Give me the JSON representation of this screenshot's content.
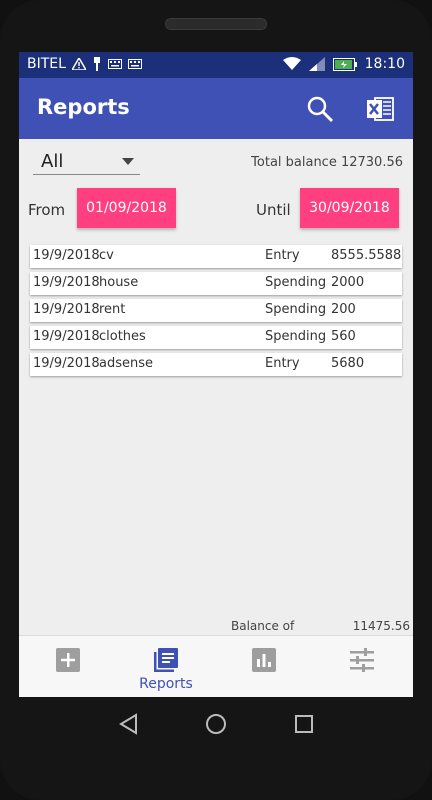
{
  "status": {
    "carrier": "BITEL",
    "time": "18:10"
  },
  "appbar": {
    "title": "Reports",
    "search_icon": "search-icon",
    "excel_icon": "excel-icon"
  },
  "filter": {
    "selected": "All",
    "total_balance": "Total balance 12730.56"
  },
  "dates": {
    "from_label": "From",
    "from_value": "01/09/2018",
    "until_label": "Until",
    "until_value": "30/09/2018"
  },
  "transactions": [
    {
      "date": "19/9/2018",
      "desc": "cv",
      "type": "Entry",
      "amount": "8555.5588"
    },
    {
      "date": "19/9/2018",
      "desc": "house",
      "type": "Spending",
      "amount": "2000"
    },
    {
      "date": "19/9/2018",
      "desc": "rent",
      "type": "Spending",
      "amount": "200"
    },
    {
      "date": "19/9/2018",
      "desc": "clothes",
      "type": "Spending",
      "amount": "560"
    },
    {
      "date": "19/9/2018",
      "desc": "adsense",
      "type": "Entry",
      "amount": "5680"
    }
  ],
  "footer": {
    "balance_label": "Balance of",
    "balance_value": "11475.56"
  },
  "bottom_nav": [
    {
      "icon": "add-icon",
      "label": ""
    },
    {
      "icon": "reports-icon",
      "label": "Reports"
    },
    {
      "icon": "chart-icon",
      "label": ""
    },
    {
      "icon": "settings-sliders-icon",
      "label": ""
    }
  ],
  "colors": {
    "primary": "#3f51b5",
    "status": "#1b2f7a",
    "accent": "#ff3f80",
    "inactive": "#9e9e9e"
  }
}
